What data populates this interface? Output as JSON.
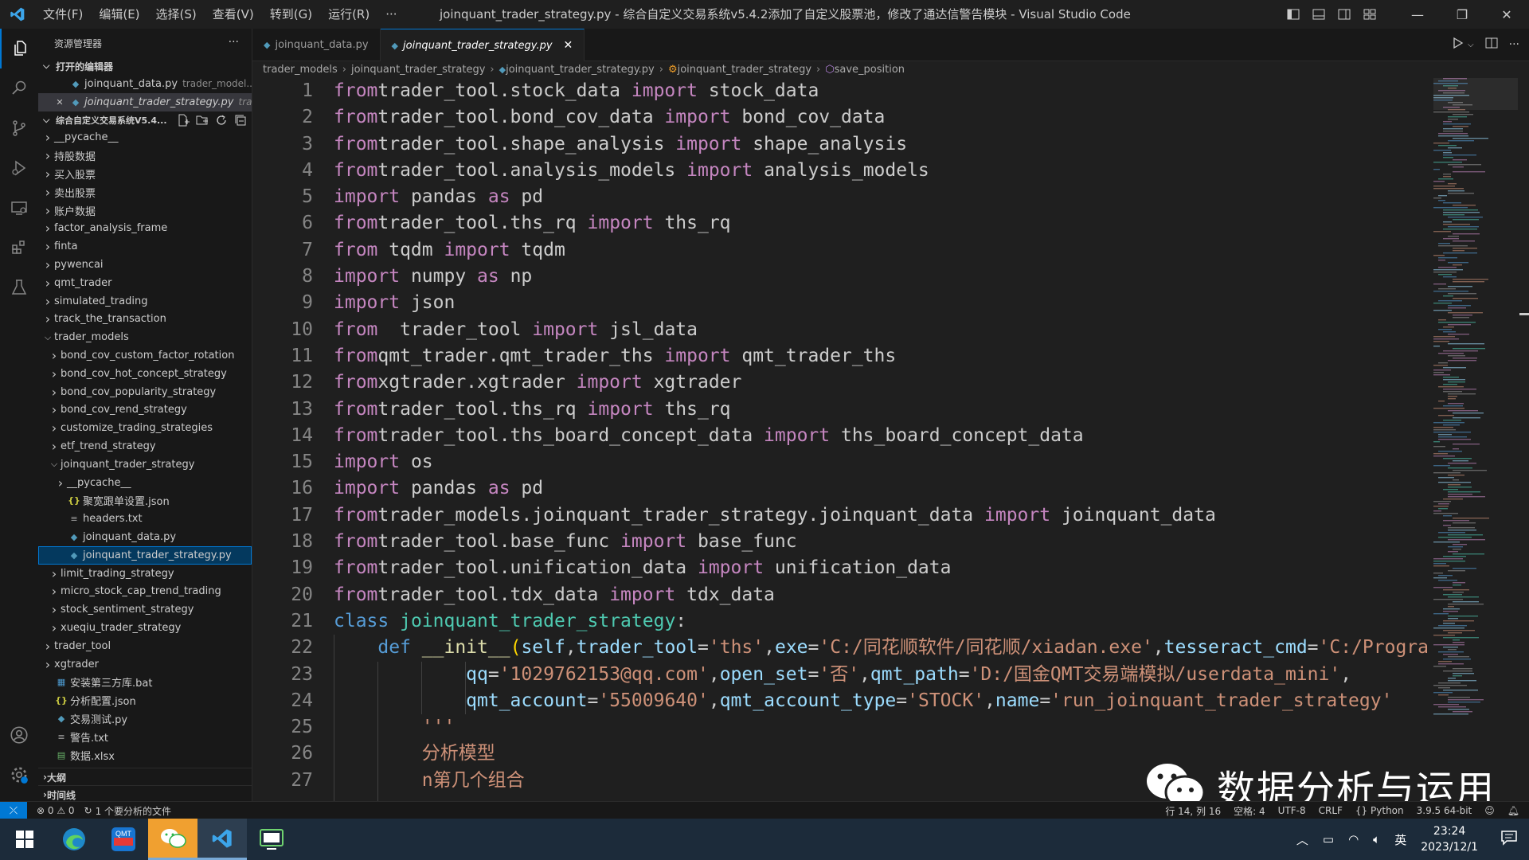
{
  "window": {
    "menu": [
      "文件(F)",
      "编辑(E)",
      "选择(S)",
      "查看(V)",
      "转到(G)",
      "运行(R)",
      "···"
    ],
    "title": "joinquant_trader_strategy.py - 综合自定义交易系统v5.4.2添加了自定义股票池，修改了通达信警告模块 - Visual Studio Code",
    "controls": {
      "minimize": "—",
      "restore": "❐",
      "close": "✕"
    }
  },
  "sidebar": {
    "header": "资源管理器",
    "more": "···",
    "open_editors_label": "打开的编辑器",
    "open_editors": [
      {
        "name": "joinquant_data.py",
        "desc": "trader_model..."
      },
      {
        "name": "joinquant_trader_strategy.py",
        "desc": "tra..."
      }
    ],
    "workspace_label": "综合自定义交易系统V5.4...",
    "tree": [
      {
        "name": "__pycache__",
        "depth": 1,
        "kind": "folder",
        "open": false
      },
      {
        "name": "持股数据",
        "depth": 1,
        "kind": "folder",
        "open": false
      },
      {
        "name": "买入股票",
        "depth": 1,
        "kind": "folder",
        "open": false
      },
      {
        "name": "卖出股票",
        "depth": 1,
        "kind": "folder",
        "open": false
      },
      {
        "name": "账户数据",
        "depth": 1,
        "kind": "folder",
        "open": false
      },
      {
        "name": "factor_analysis_frame",
        "depth": 1,
        "kind": "folder",
        "open": false
      },
      {
        "name": "finta",
        "depth": 1,
        "kind": "folder",
        "open": false
      },
      {
        "name": "pywencai",
        "depth": 1,
        "kind": "folder",
        "open": false
      },
      {
        "name": "qmt_trader",
        "depth": 1,
        "kind": "folder",
        "open": false
      },
      {
        "name": "simulated_trading",
        "depth": 1,
        "kind": "folder",
        "open": false
      },
      {
        "name": "track_the_transaction",
        "depth": 1,
        "kind": "folder",
        "open": false
      },
      {
        "name": "trader_models",
        "depth": 1,
        "kind": "folder",
        "open": true
      },
      {
        "name": "bond_cov_custom_factor_rotation",
        "depth": 2,
        "kind": "folder",
        "open": false
      },
      {
        "name": "bond_cov_hot_concept_strategy",
        "depth": 2,
        "kind": "folder",
        "open": false
      },
      {
        "name": "bond_cov_popularity_strategy",
        "depth": 2,
        "kind": "folder",
        "open": false
      },
      {
        "name": "bond_cov_rend_strategy",
        "depth": 2,
        "kind": "folder",
        "open": false
      },
      {
        "name": "customize_trading_strategies",
        "depth": 2,
        "kind": "folder",
        "open": false
      },
      {
        "name": "etf_trend_strategy",
        "depth": 2,
        "kind": "folder",
        "open": false
      },
      {
        "name": "joinquant_trader_strategy",
        "depth": 2,
        "kind": "folder",
        "open": true
      },
      {
        "name": "__pycache__",
        "depth": 3,
        "kind": "folder",
        "open": false
      },
      {
        "name": "聚宽跟单设置.json",
        "depth": 3,
        "kind": "json"
      },
      {
        "name": "headers.txt",
        "depth": 3,
        "kind": "txt"
      },
      {
        "name": "joinquant_data.py",
        "depth": 3,
        "kind": "py"
      },
      {
        "name": "joinquant_trader_strategy.py",
        "depth": 3,
        "kind": "py",
        "selected": true
      },
      {
        "name": "limit_trading_strategy",
        "depth": 2,
        "kind": "folder",
        "open": false
      },
      {
        "name": "micro_stock_cap_trend_trading",
        "depth": 2,
        "kind": "folder",
        "open": false
      },
      {
        "name": "stock_sentiment_strategy",
        "depth": 2,
        "kind": "folder",
        "open": false
      },
      {
        "name": "xueqiu_trader_strategy",
        "depth": 2,
        "kind": "folder",
        "open": false
      },
      {
        "name": "trader_tool",
        "depth": 1,
        "kind": "folder",
        "open": false
      },
      {
        "name": "xgtrader",
        "depth": 1,
        "kind": "folder",
        "open": false
      },
      {
        "name": "安装第三方库.bat",
        "depth": 1,
        "kind": "bat"
      },
      {
        "name": "分析配置.json",
        "depth": 1,
        "kind": "json"
      },
      {
        "name": "交易测试.py",
        "depth": 1,
        "kind": "py"
      },
      {
        "name": "警告.txt",
        "depth": 1,
        "kind": "txt"
      },
      {
        "name": "数据.xlsx",
        "depth": 1,
        "kind": "xls"
      }
    ],
    "outline_label": "大纲",
    "timeline_label": "时间线"
  },
  "tabs": [
    {
      "name": "joinquant_data.py",
      "active": false
    },
    {
      "name": "joinquant_trader_strategy.py",
      "active": true,
      "close": "✕"
    }
  ],
  "breadcrumb": [
    "trader_models",
    "joinquant_trader_strategy",
    "joinquant_trader_strategy.py",
    "joinquant_trader_strategy",
    "save_position"
  ],
  "code_lines": [
    [
      [
        "kw",
        "from"
      ],
      [
        "",
        "trader_tool.stock_data "
      ],
      [
        "kw",
        "import"
      ],
      [
        "",
        " stock_data"
      ]
    ],
    [
      [
        "kw",
        "from"
      ],
      [
        "",
        "trader_tool.bond_cov_data "
      ],
      [
        "kw",
        "import"
      ],
      [
        "",
        " bond_cov_data"
      ]
    ],
    [
      [
        "kw",
        "from"
      ],
      [
        "",
        "trader_tool.shape_analysis "
      ],
      [
        "kw",
        "import"
      ],
      [
        "",
        " shape_analysis"
      ]
    ],
    [
      [
        "kw",
        "from"
      ],
      [
        "",
        "trader_tool.analysis_models "
      ],
      [
        "kw",
        "import"
      ],
      [
        "",
        " analysis_models"
      ]
    ],
    [
      [
        "kw",
        "import"
      ],
      [
        "",
        " pandas "
      ],
      [
        "kw",
        "as"
      ],
      [
        "",
        " pd"
      ]
    ],
    [
      [
        "kw",
        "from"
      ],
      [
        "",
        "trader_tool.ths_rq "
      ],
      [
        "kw",
        "import"
      ],
      [
        "",
        " ths_rq"
      ]
    ],
    [
      [
        "kw",
        "from"
      ],
      [
        "",
        " tqdm "
      ],
      [
        "kw",
        "import"
      ],
      [
        "",
        " tqdm"
      ]
    ],
    [
      [
        "kw",
        "import"
      ],
      [
        "",
        " numpy "
      ],
      [
        "kw",
        "as"
      ],
      [
        "",
        " np"
      ]
    ],
    [
      [
        "kw",
        "import"
      ],
      [
        "",
        " json"
      ]
    ],
    [
      [
        "kw",
        "from"
      ],
      [
        "",
        "  trader_tool "
      ],
      [
        "kw",
        "import"
      ],
      [
        "",
        " jsl_data"
      ]
    ],
    [
      [
        "kw",
        "from"
      ],
      [
        "",
        "qmt_trader.qmt_trader_ths "
      ],
      [
        "kw",
        "import"
      ],
      [
        "",
        " qmt_trader_ths"
      ]
    ],
    [
      [
        "kw",
        "from"
      ],
      [
        "",
        "xgtrader.xgtrader "
      ],
      [
        "kw",
        "import"
      ],
      [
        "",
        " xgtrader"
      ]
    ],
    [
      [
        "kw",
        "from"
      ],
      [
        "",
        "trader_tool.ths_rq "
      ],
      [
        "kw",
        "import"
      ],
      [
        "",
        " ths_rq"
      ]
    ],
    [
      [
        "kw",
        "from"
      ],
      [
        "",
        "trader_tool.ths_board_concept_data "
      ],
      [
        "kw",
        "import"
      ],
      [
        "",
        " ths_board_concept_data"
      ]
    ],
    [
      [
        "kw",
        "import"
      ],
      [
        "",
        " os"
      ]
    ],
    [
      [
        "kw",
        "import"
      ],
      [
        "",
        " pandas "
      ],
      [
        "kw",
        "as"
      ],
      [
        "",
        " pd"
      ]
    ],
    [
      [
        "kw",
        "from"
      ],
      [
        "",
        "trader_models.joinquant_trader_strategy.joinquant_data "
      ],
      [
        "kw",
        "import"
      ],
      [
        "",
        " joinquant_data"
      ]
    ],
    [
      [
        "kw",
        "from"
      ],
      [
        "",
        "trader_tool.base_func "
      ],
      [
        "kw",
        "import"
      ],
      [
        "",
        " base_func"
      ]
    ],
    [
      [
        "kw",
        "from"
      ],
      [
        "",
        "trader_tool.unification_data "
      ],
      [
        "kw",
        "import"
      ],
      [
        "",
        " unification_data"
      ]
    ],
    [
      [
        "kw",
        "from"
      ],
      [
        "",
        "trader_tool.tdx_data "
      ],
      [
        "kw",
        "import"
      ],
      [
        "",
        " tdx_data"
      ]
    ],
    [
      [
        "kb",
        "class"
      ],
      [
        "",
        " "
      ],
      [
        "cls",
        "joinquant_trader_strategy"
      ],
      [
        "",
        ":"
      ]
    ],
    [
      [
        "",
        "    "
      ],
      [
        "kb",
        "def"
      ],
      [
        "",
        " "
      ],
      [
        "fn",
        "__init__"
      ],
      [
        "pn",
        "("
      ],
      [
        "prm",
        "self"
      ],
      [
        "",
        ","
      ],
      [
        "prm",
        "trader_tool"
      ],
      [
        "",
        "="
      ],
      [
        "str",
        "'ths'"
      ],
      [
        "",
        ","
      ],
      [
        "prm",
        "exe"
      ],
      [
        "",
        "="
      ],
      [
        "str",
        "'C:/同花顺软件/同花顺/xiadan.exe'"
      ],
      [
        "",
        ","
      ],
      [
        "prm",
        "tesseract_cmd"
      ],
      [
        "",
        "="
      ],
      [
        "str",
        "'C:/Progra"
      ]
    ],
    [
      [
        "",
        "            "
      ],
      [
        "prm",
        "qq"
      ],
      [
        "",
        "="
      ],
      [
        "str",
        "'1029762153@qq.com'"
      ],
      [
        "",
        ","
      ],
      [
        "prm",
        "open_set"
      ],
      [
        "",
        "="
      ],
      [
        "str",
        "'否'"
      ],
      [
        "",
        ","
      ],
      [
        "prm",
        "qmt_path"
      ],
      [
        "",
        "="
      ],
      [
        "str",
        "'D:/国金QMT交易端模拟/userdata_mini'"
      ],
      [
        "",
        ","
      ]
    ],
    [
      [
        "",
        "            "
      ],
      [
        "prm",
        "qmt_account"
      ],
      [
        "",
        "="
      ],
      [
        "str",
        "'55009640'"
      ],
      [
        "",
        ","
      ],
      [
        "prm",
        "qmt_account_type"
      ],
      [
        "",
        "="
      ],
      [
        "str",
        "'STOCK'"
      ],
      [
        "",
        ","
      ],
      [
        "prm",
        "name"
      ],
      [
        "",
        "="
      ],
      [
        "str",
        "'run_joinquant_trader_strategy'"
      ]
    ],
    [
      [
        "",
        "        "
      ],
      [
        "str",
        "'''"
      ]
    ],
    [
      [
        "",
        "        "
      ],
      [
        "str",
        "分析模型"
      ]
    ],
    [
      [
        "",
        "        "
      ],
      [
        "str",
        "n第几个组合"
      ]
    ]
  ],
  "status": {
    "remote_icon": "remote-icon",
    "problems": "⊗ 0 ⚠ 0",
    "sync": "1 个要分析的文件",
    "position": "行 14, 列 16",
    "spaces": "空格: 4",
    "encoding": "UTF-8",
    "eol": "CRLF",
    "language": "Python",
    "interpreter": "3.9.5 64-bit"
  },
  "watermark": "数据分析与运用",
  "taskbar": {
    "clock_time": "23:24",
    "clock_date": "2023/12/1",
    "ime": "英"
  },
  "colors": {
    "accent": "#0078d4",
    "keyword": "#c586c0",
    "string": "#ce9178",
    "class": "#4ec9b0"
  }
}
